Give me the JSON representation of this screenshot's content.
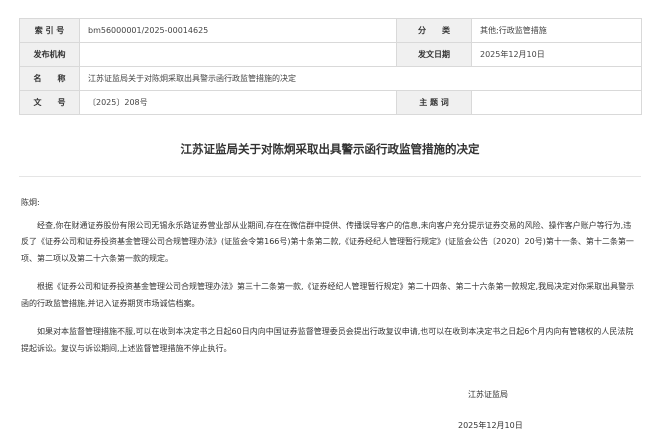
{
  "meta": {
    "rows": [
      {
        "label1": "索 引 号",
        "value1": "bm56000001/2025-00014625",
        "label2": "分　　类",
        "value2": "其他;行政监管措施"
      },
      {
        "label1": "发布机构",
        "value1": "",
        "label2": "发文日期",
        "value2": "2025年12月10日"
      },
      {
        "label1": "名　　称",
        "value1": "江苏证监局关于对陈炯采取出具警示函行政监管措施的决定"
      },
      {
        "label1": "文　　号",
        "value1": "〔2025〕208号",
        "label2": "主 题 词",
        "value2": ""
      }
    ]
  },
  "document": {
    "title": "江苏证监局关于对陈炯采取出具警示函行政监管措施的决定",
    "salutation": "陈炯:",
    "paragraphs": [
      "经查,你在财通证券股份有限公司无锡永乐路证券营业部从业期间,存在在微信群中提供、传播误导客户的信息,未向客户充分提示证券交易的风险、操作客户账户等行为,违反了《证券公司和证券投资基金管理公司合规管理办法》(证监会令第166号)第十条第二款,《证券经纪人管理暂行规定》(证监会公告〔2020〕20号)第十一条、第十二条第一项、第二项以及第二十六条第一款的规定。",
      "根据《证券公司和证券投资基金管理公司合规管理办法》第三十二条第一款,《证券经纪人管理暂行规定》第二十四条、第二十六条第一款规定,我局决定对你采取出具警示函的行政监管措施,并记入证券期货市场诚信档案。",
      "如果对本监督管理措施不服,可以在收到本决定书之日起60日内向中国证券监督管理委员会提出行政复议申请,也可以在收到本决定书之日起6个月内向有管辖权的人民法院提起诉讼。复议与诉讼期间,上述监督管理措施不停止执行。"
    ],
    "signature": "江苏证监局",
    "date": "2025年12月10日"
  }
}
